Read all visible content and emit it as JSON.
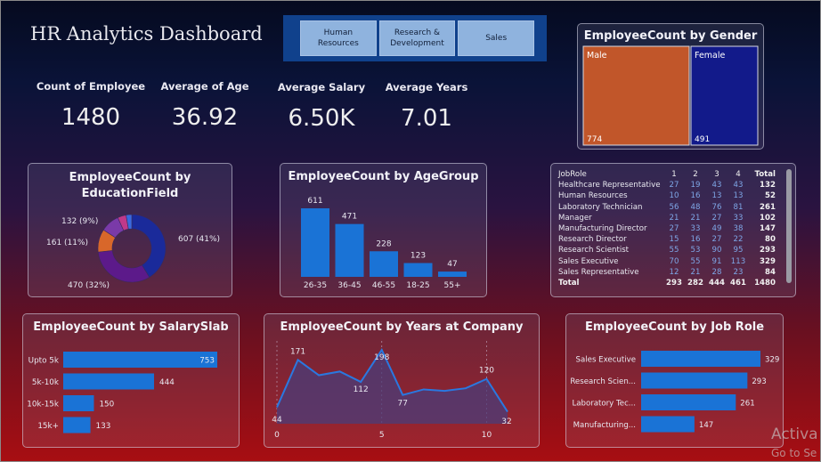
{
  "header": {
    "title": "HR Analytics Dashboard"
  },
  "nav": {
    "buttons": [
      "Human\nResources",
      "Research &\nDevelopment",
      "Sales"
    ]
  },
  "kpis": [
    {
      "label": "Count of Employee",
      "value": "1480"
    },
    {
      "label": "Average of Age",
      "value": "36.92"
    },
    {
      "label": "Average Salary",
      "value": "6.50K"
    },
    {
      "label": "Average Years",
      "value": "7.01"
    }
  ],
  "colors": {
    "bar": "#1a73d6",
    "male": "#c1562a",
    "female": "#121a8a",
    "area": "#4a3c7a",
    "line": "#2a78e0"
  },
  "chart_data": [
    {
      "id": "gender",
      "type": "treemap",
      "title": "EmployeeCount by Gender",
      "categories": [
        "Male",
        "Female"
      ],
      "values": [
        774,
        491
      ]
    },
    {
      "id": "education",
      "type": "pie",
      "title": "EmployeeCount by\nEducationField",
      "slices": [
        {
          "value": 607,
          "pct": 41,
          "label": "607 (41%)",
          "color": "#1a2a9a"
        },
        {
          "value": 470,
          "pct": 32,
          "label": "470 (32%)",
          "color": "#5c1a8a"
        },
        {
          "value": 161,
          "pct": 11,
          "label": "161 (11%)",
          "color": "#d8672a"
        },
        {
          "value": 132,
          "pct": 9,
          "label": "132 (9%)",
          "color": "#7a3aa8"
        },
        {
          "value": 60,
          "pct": 4,
          "label": "",
          "color": "#c0398a"
        },
        {
          "value": 40,
          "pct": 3,
          "label": "",
          "color": "#3a6adf"
        }
      ]
    },
    {
      "id": "agegroup",
      "type": "bar",
      "title": "EmployeeCount by AgeGroup",
      "categories": [
        "26-35",
        "36-45",
        "46-55",
        "18-25",
        "55+"
      ],
      "values": [
        611,
        471,
        228,
        123,
        47
      ]
    },
    {
      "id": "salary",
      "type": "bar",
      "orientation": "horizontal",
      "title": "EmployeeCount by SalarySlab",
      "categories": [
        "Upto 5k",
        "5k-10k",
        "10k-15k",
        "15k+"
      ],
      "values": [
        753,
        444,
        150,
        133
      ]
    },
    {
      "id": "years",
      "type": "area",
      "title": "EmployeeCount by Years at Company",
      "x": [
        0,
        1,
        2,
        3,
        4,
        5,
        6,
        7,
        8,
        9,
        10,
        11
      ],
      "values": [
        44,
        171,
        130,
        140,
        112,
        198,
        77,
        92,
        88,
        95,
        120,
        32
      ],
      "labels_at": [
        0,
        1,
        4,
        5,
        6,
        10,
        11
      ],
      "x_ticks": [
        "0",
        "5",
        "10"
      ]
    },
    {
      "id": "jobrole",
      "type": "bar",
      "orientation": "horizontal",
      "title": "EmployeeCount by Job Role",
      "categories": [
        "Sales Executive",
        "Research Scien...",
        "Laboratory Tec...",
        "Manufacturing..."
      ],
      "values": [
        329,
        293,
        261,
        147
      ]
    }
  ],
  "jobrole_table": {
    "headers": [
      "JobRole",
      "1",
      "2",
      "3",
      "4",
      "Total"
    ],
    "rows": [
      [
        "Healthcare Representative",
        "27",
        "19",
        "43",
        "43",
        "132"
      ],
      [
        "Human Resources",
        "10",
        "16",
        "13",
        "13",
        "52"
      ],
      [
        "Laboratory Technician",
        "56",
        "48",
        "76",
        "81",
        "261"
      ],
      [
        "Manager",
        "21",
        "21",
        "27",
        "33",
        "102"
      ],
      [
        "Manufacturing Director",
        "27",
        "33",
        "49",
        "38",
        "147"
      ],
      [
        "Research Director",
        "15",
        "16",
        "27",
        "22",
        "80"
      ],
      [
        "Research Scientist",
        "55",
        "53",
        "90",
        "95",
        "293"
      ],
      [
        "Sales Executive",
        "70",
        "55",
        "91",
        "113",
        "329"
      ],
      [
        "Sales Representative",
        "12",
        "21",
        "28",
        "23",
        "84"
      ]
    ],
    "total": [
      "Total",
      "293",
      "282",
      "444",
      "461",
      "1480"
    ]
  },
  "watermark": {
    "line1": "Activa",
    "line2": "Go to Se"
  }
}
